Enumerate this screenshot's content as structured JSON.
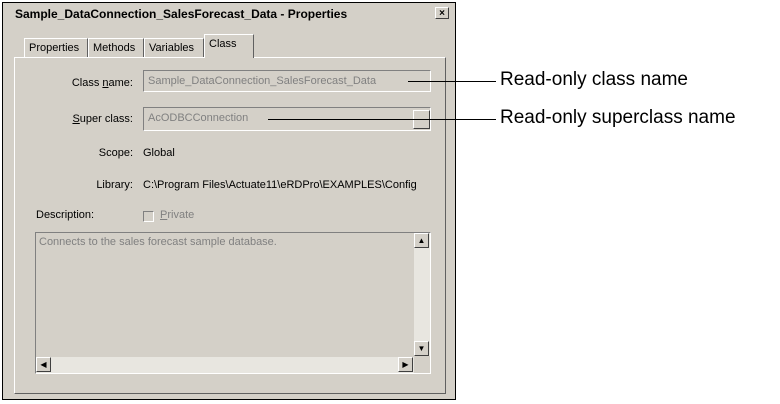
{
  "window": {
    "title": "Sample_DataConnection_SalesForecast_Data - Properties",
    "close_glyph": "×"
  },
  "tabs": [
    {
      "label": "Properties"
    },
    {
      "label": "Methods"
    },
    {
      "label": "Variables"
    },
    {
      "label": "Class",
      "active": true
    }
  ],
  "form": {
    "class_name_label_pre": "Class ",
    "class_name_label_u": "n",
    "class_name_label_post": "ame:",
    "class_name_value": "Sample_DataConnection_SalesForecast_Data",
    "super_class_label_u": "S",
    "super_class_label_post": "uper class:",
    "super_class_value": "AcODBCConnection",
    "scope_label": "Scope:",
    "scope_value": "Global",
    "library_label": "Library:",
    "library_value": "C:\\Program Files\\Actuate11\\eRDPro\\EXAMPLES\\Config",
    "description_label": "Description:",
    "private_label_u": "P",
    "private_label_post": "rivate",
    "description_text": "Connects to the sales forecast sample database."
  },
  "callouts": {
    "class_name": "Read-only class name",
    "super_class": "Read-only superclass name"
  }
}
